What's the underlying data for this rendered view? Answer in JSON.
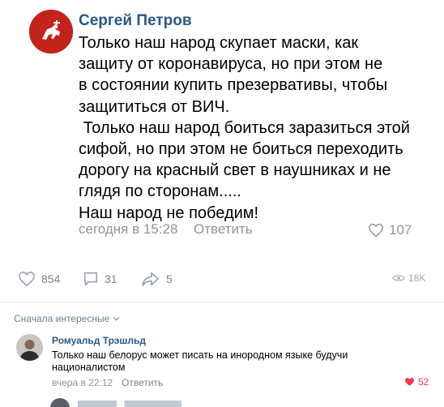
{
  "post": {
    "author": "Сергей Петров",
    "lines": [
      "Только наш народ скупает маски, как",
      "защиту от коронавируса, но при этом не",
      "в состоянии купить презервативы, чтобы",
      "защититься от ВИЧ.",
      " Только наш народ боиться заразиться этой",
      "сифой, но при этом не боиться переходить",
      "дорогу на красный свет в наушниках и не",
      "глядя по сторонам.....",
      "Наш народ не победим!"
    ],
    "timestamp": "сегодня в 15:28",
    "reply_label": "Ответить",
    "likes": "107"
  },
  "actions": {
    "likes": "854",
    "comments": "31",
    "shares": "5",
    "views": "18K"
  },
  "sort_label": "Сначала интересные",
  "comment": {
    "author": "Ромуальд Трэшльд",
    "text_line1": "Только наш белорус может писать на инородном языке будучи",
    "text_line2": "националистом",
    "timestamp": "вчера в 22:12",
    "reply_label": "Ответить",
    "likes": "52"
  },
  "colors": {
    "link": "#2a5885",
    "meta": "#939393",
    "like_active": "#ff3347",
    "avatar_red": "#c2231b"
  }
}
